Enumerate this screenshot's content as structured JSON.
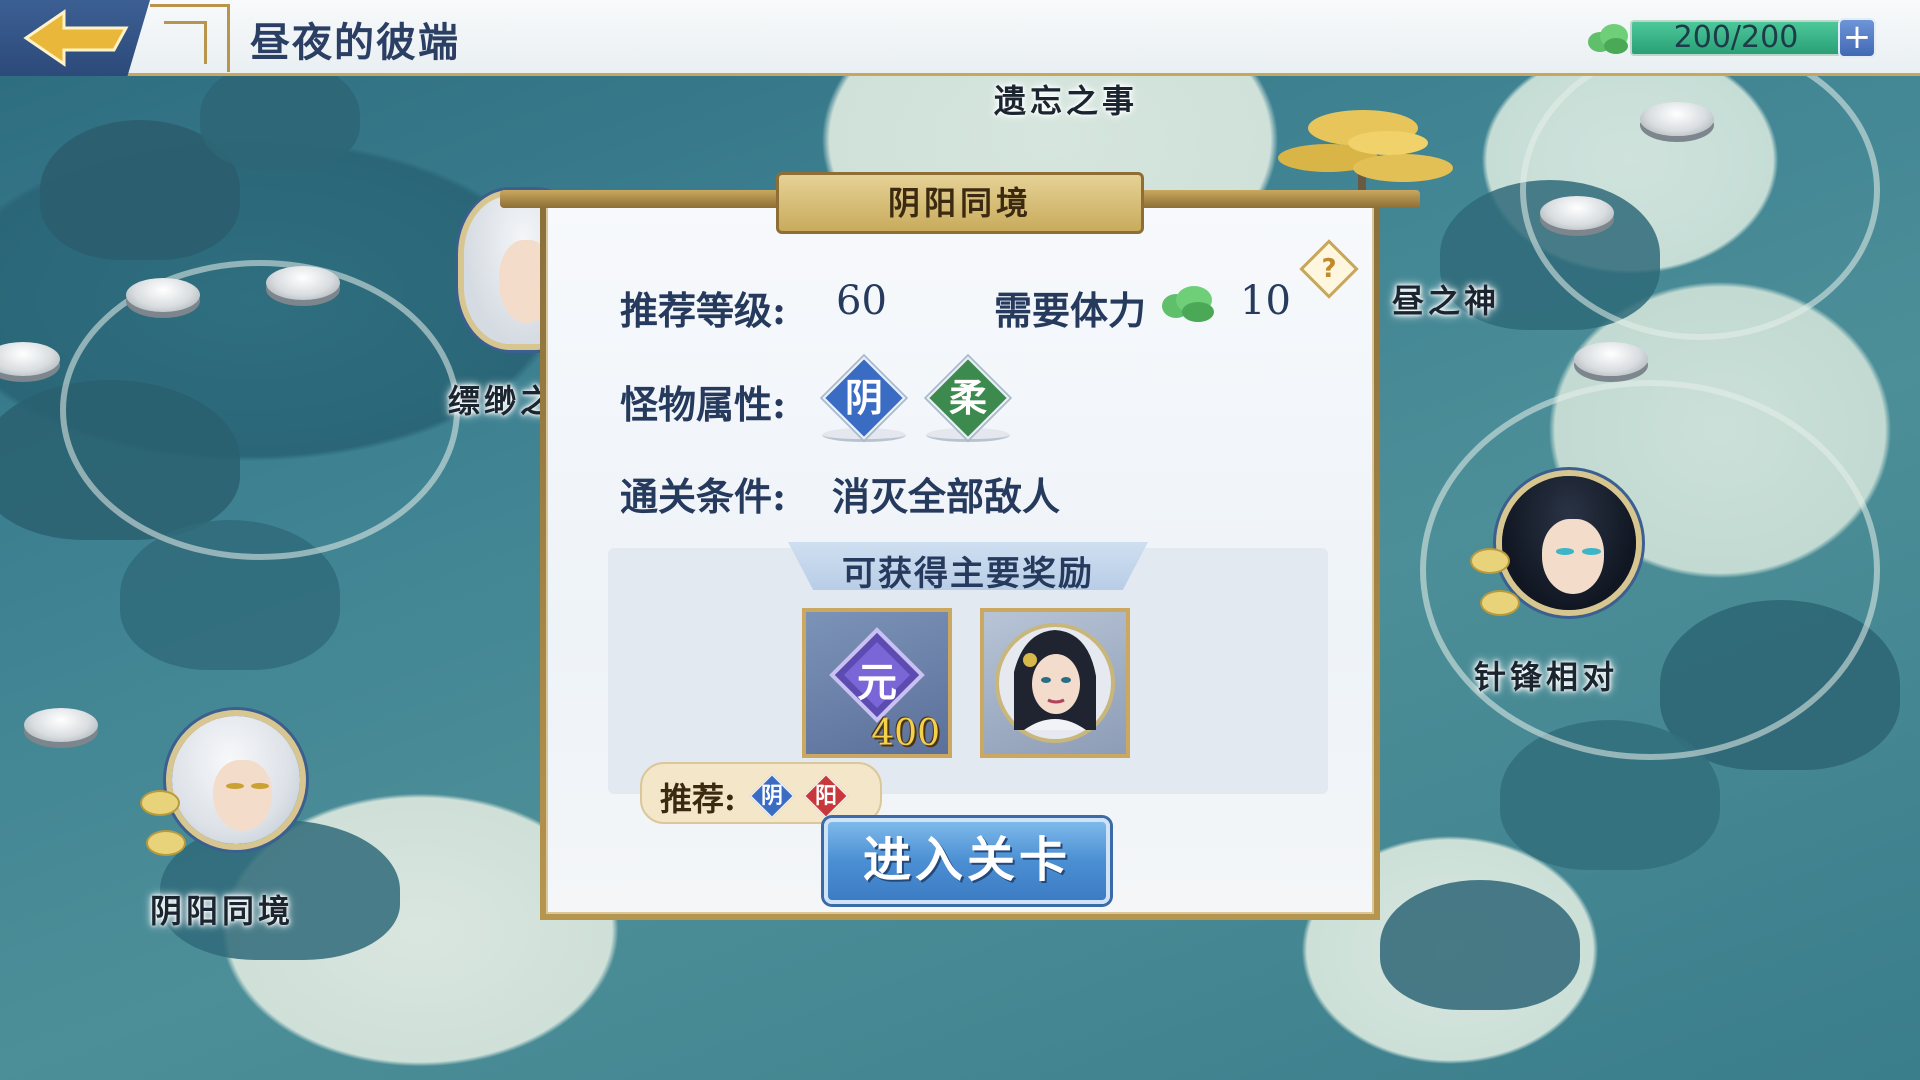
{
  "header": {
    "title": "昼夜的彼端",
    "stamina_value": "200/200",
    "stamina_plus": "+"
  },
  "map": {
    "labels": {
      "forgotten": "遗忘之事",
      "day_god": "昼之神",
      "misty": "缥缈之",
      "yinyang": "阴阳同境",
      "confront": "针锋相对"
    }
  },
  "dialog": {
    "title": "阴阳同境",
    "help": "?",
    "level_label": "推荐等级:",
    "level_value": "60",
    "stamina_label": "需要体力",
    "stamina_value": "10",
    "attr_label": "怪物属性:",
    "attributes": [
      {
        "text": "阴",
        "color": "#3a6cc4"
      },
      {
        "text": "柔",
        "color": "#3c8a4e"
      }
    ],
    "clear_label": "通关条件:",
    "clear_value": "消灭全部敌人",
    "reward_title": "可获得主要奖励",
    "reward_item_symbol": "元",
    "reward_item_count": "400",
    "recommend_label": "推荐:",
    "recommend": [
      {
        "text": "阴",
        "color": "#3a6cc4"
      },
      {
        "text": "阳",
        "color": "#c8383a"
      }
    ],
    "enter_button": "进入关卡"
  }
}
